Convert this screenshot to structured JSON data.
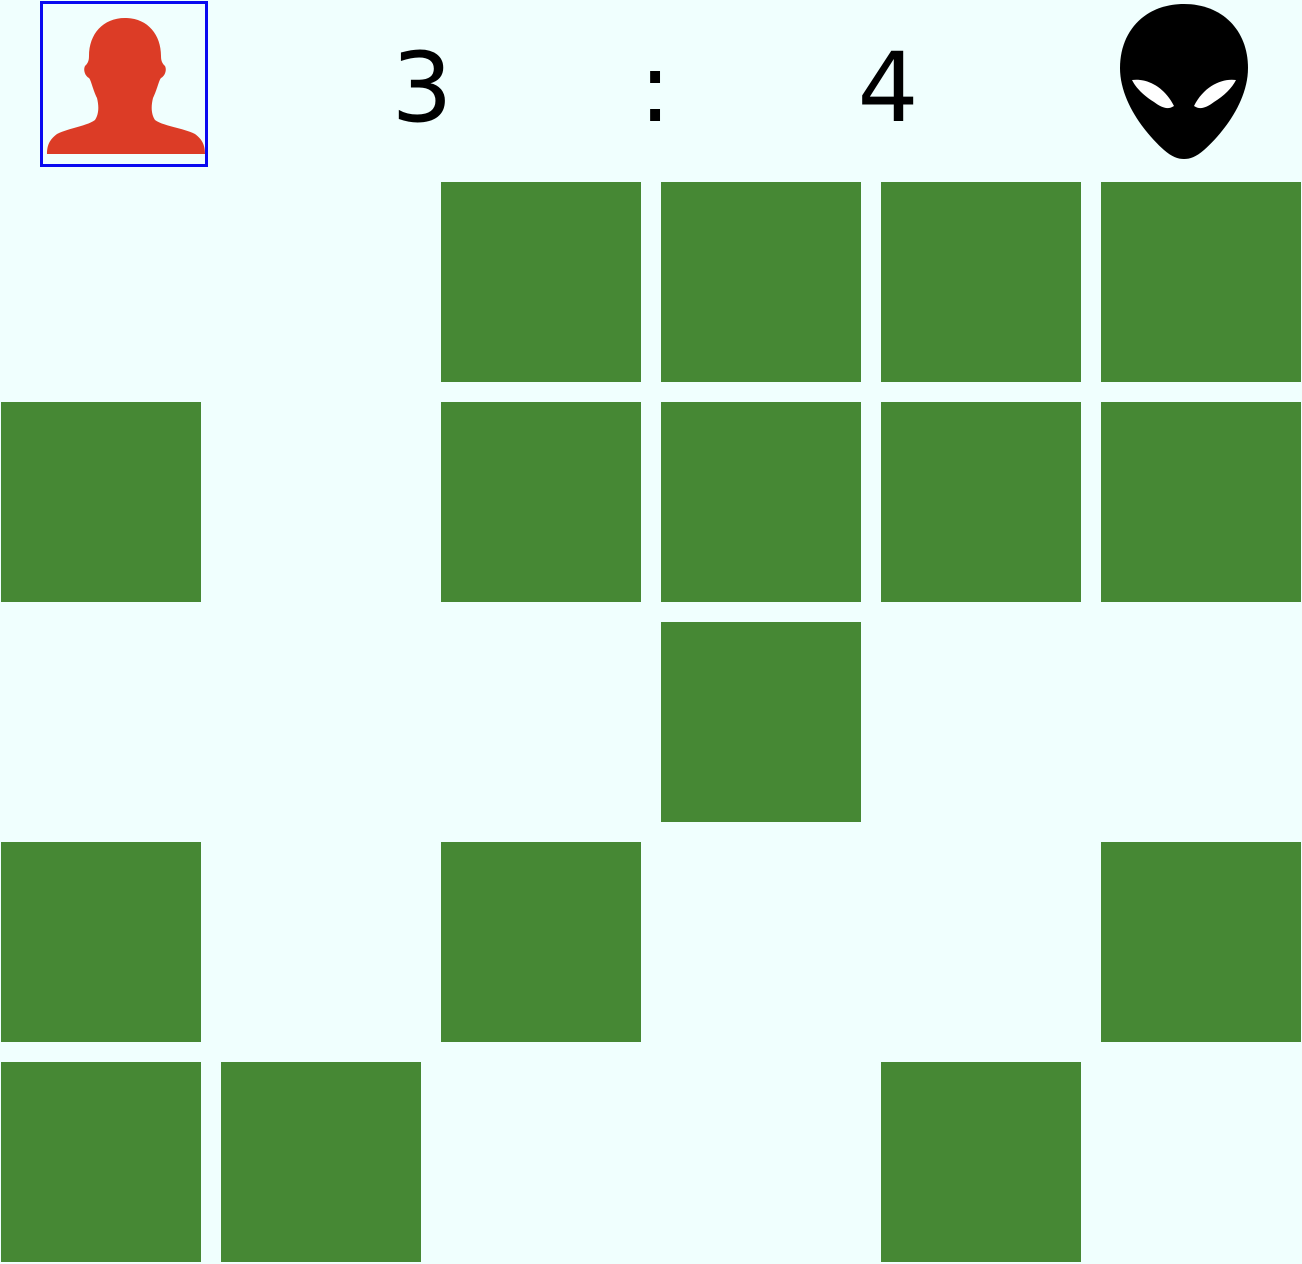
{
  "header": {
    "player_icon": "player-silhouette-icon",
    "ai_icon": "alien-head-icon",
    "score_player": "3",
    "separator": ":",
    "score_ai": "4",
    "active_player": "player",
    "highlight_color": "#0a0af0",
    "player_color": "#dc3c26",
    "ai_color": "#000000"
  },
  "board": {
    "rows": 5,
    "cols": 6,
    "tile_color": "#468834",
    "background_color": "#f0fffe",
    "grid": [
      [
        0,
        0,
        1,
        1,
        1,
        1
      ],
      [
        1,
        0,
        1,
        1,
        1,
        1
      ],
      [
        0,
        0,
        0,
        1,
        0,
        0
      ],
      [
        1,
        0,
        1,
        0,
        0,
        1
      ],
      [
        1,
        1,
        0,
        0,
        1,
        0
      ]
    ]
  }
}
